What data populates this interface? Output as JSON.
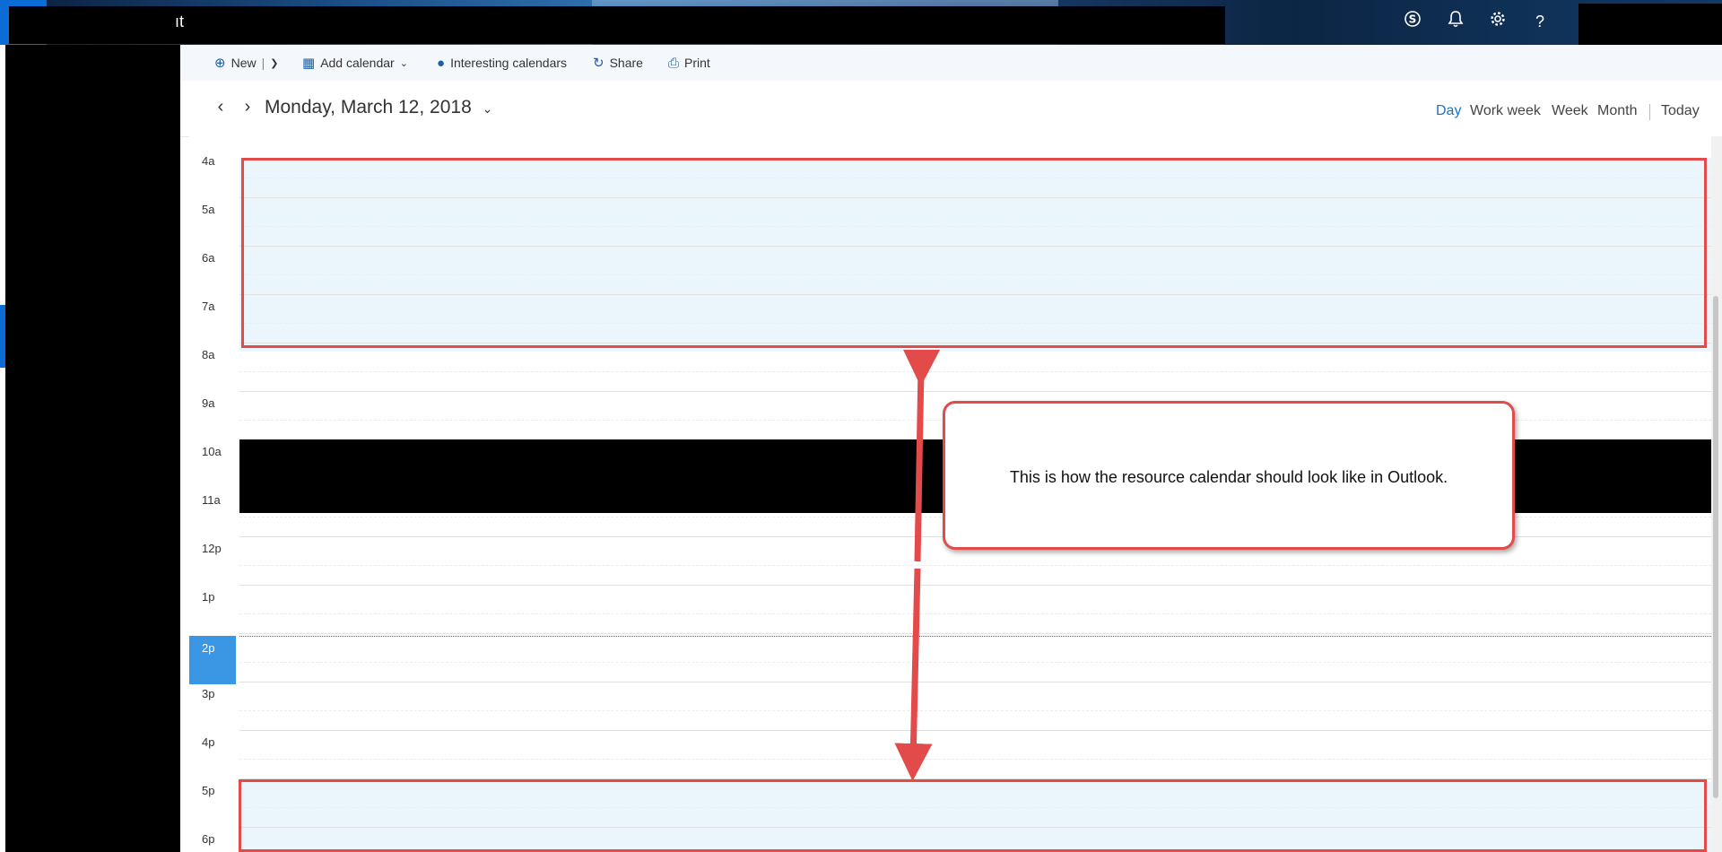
{
  "topbar": {
    "app_name_fragment": "ıt",
    "icons": [
      "skype-icon",
      "bell-icon",
      "gear-icon",
      "help-icon"
    ]
  },
  "command_bar": {
    "new_label": "New",
    "add_calendar_label": "Add calendar",
    "interesting_calendars_label": "Interesting calendars",
    "share_label": "Share",
    "print_label": "Print"
  },
  "date_header": {
    "title": "Monday, March 12, 2018",
    "views": [
      "Day",
      "Work week",
      "Week",
      "Month"
    ],
    "active_view": "Day",
    "today_label": "Today"
  },
  "calendar": {
    "hours": [
      "4a",
      "5a",
      "6a",
      "7a",
      "8a",
      "9a",
      "10a",
      "11a",
      "12p",
      "1p",
      "2p",
      "3p",
      "4p",
      "5p",
      "6p"
    ],
    "current_hour": "2p"
  },
  "annotation": {
    "callout_text": "This is how the resource calendar should look like in Outlook."
  },
  "colors": {
    "accent": "#1a73c8",
    "annotation_red": "#e34a4a",
    "off_hours_shade": "#eaf5fc",
    "now_badge": "#3b97e3"
  }
}
